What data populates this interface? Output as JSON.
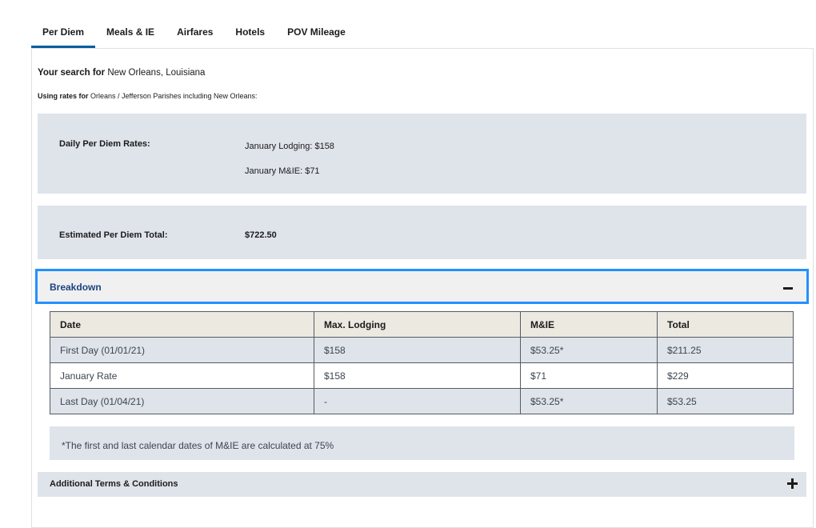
{
  "tabs": [
    {
      "label": "Per Diem",
      "active": true
    },
    {
      "label": "Meals & IE",
      "active": false
    },
    {
      "label": "Airfares",
      "active": false
    },
    {
      "label": "Hotels",
      "active": false
    },
    {
      "label": "POV Mileage",
      "active": false
    }
  ],
  "search": {
    "prefix": "Your search for",
    "location": "New Orleans, Louisiana",
    "rates_prefix": "Using rates for",
    "rates_location": "Orleans / Jefferson Parishes including New Orleans:"
  },
  "daily_rates": {
    "label": "Daily Per Diem Rates:",
    "lodging": "January Lodging: $158",
    "mie": "January M&IE: $71"
  },
  "estimate": {
    "label": "Estimated Per Diem Total:",
    "value": "$722.50"
  },
  "breakdown": {
    "title": "Breakdown",
    "expanded": true,
    "headers": [
      "Date",
      "Max. Lodging",
      "M&IE",
      "Total"
    ],
    "rows": [
      [
        "First Day (01/01/21)",
        "$158",
        "$53.25*",
        "$211.25"
      ],
      [
        "January Rate",
        "$158",
        "$71",
        "$229"
      ],
      [
        "Last Day (01/04/21)",
        "-",
        "$53.25*",
        "$53.25"
      ]
    ],
    "note": "*The first and last calendar dates of M&IE are calculated at 75%"
  },
  "terms": {
    "title": "Additional Terms & Conditions",
    "expanded": false
  },
  "colors": {
    "accent": "#005ea2",
    "focus": "#2491ff",
    "panel_bg": "#dfe3ea",
    "header_bg": "#ece9e1"
  }
}
